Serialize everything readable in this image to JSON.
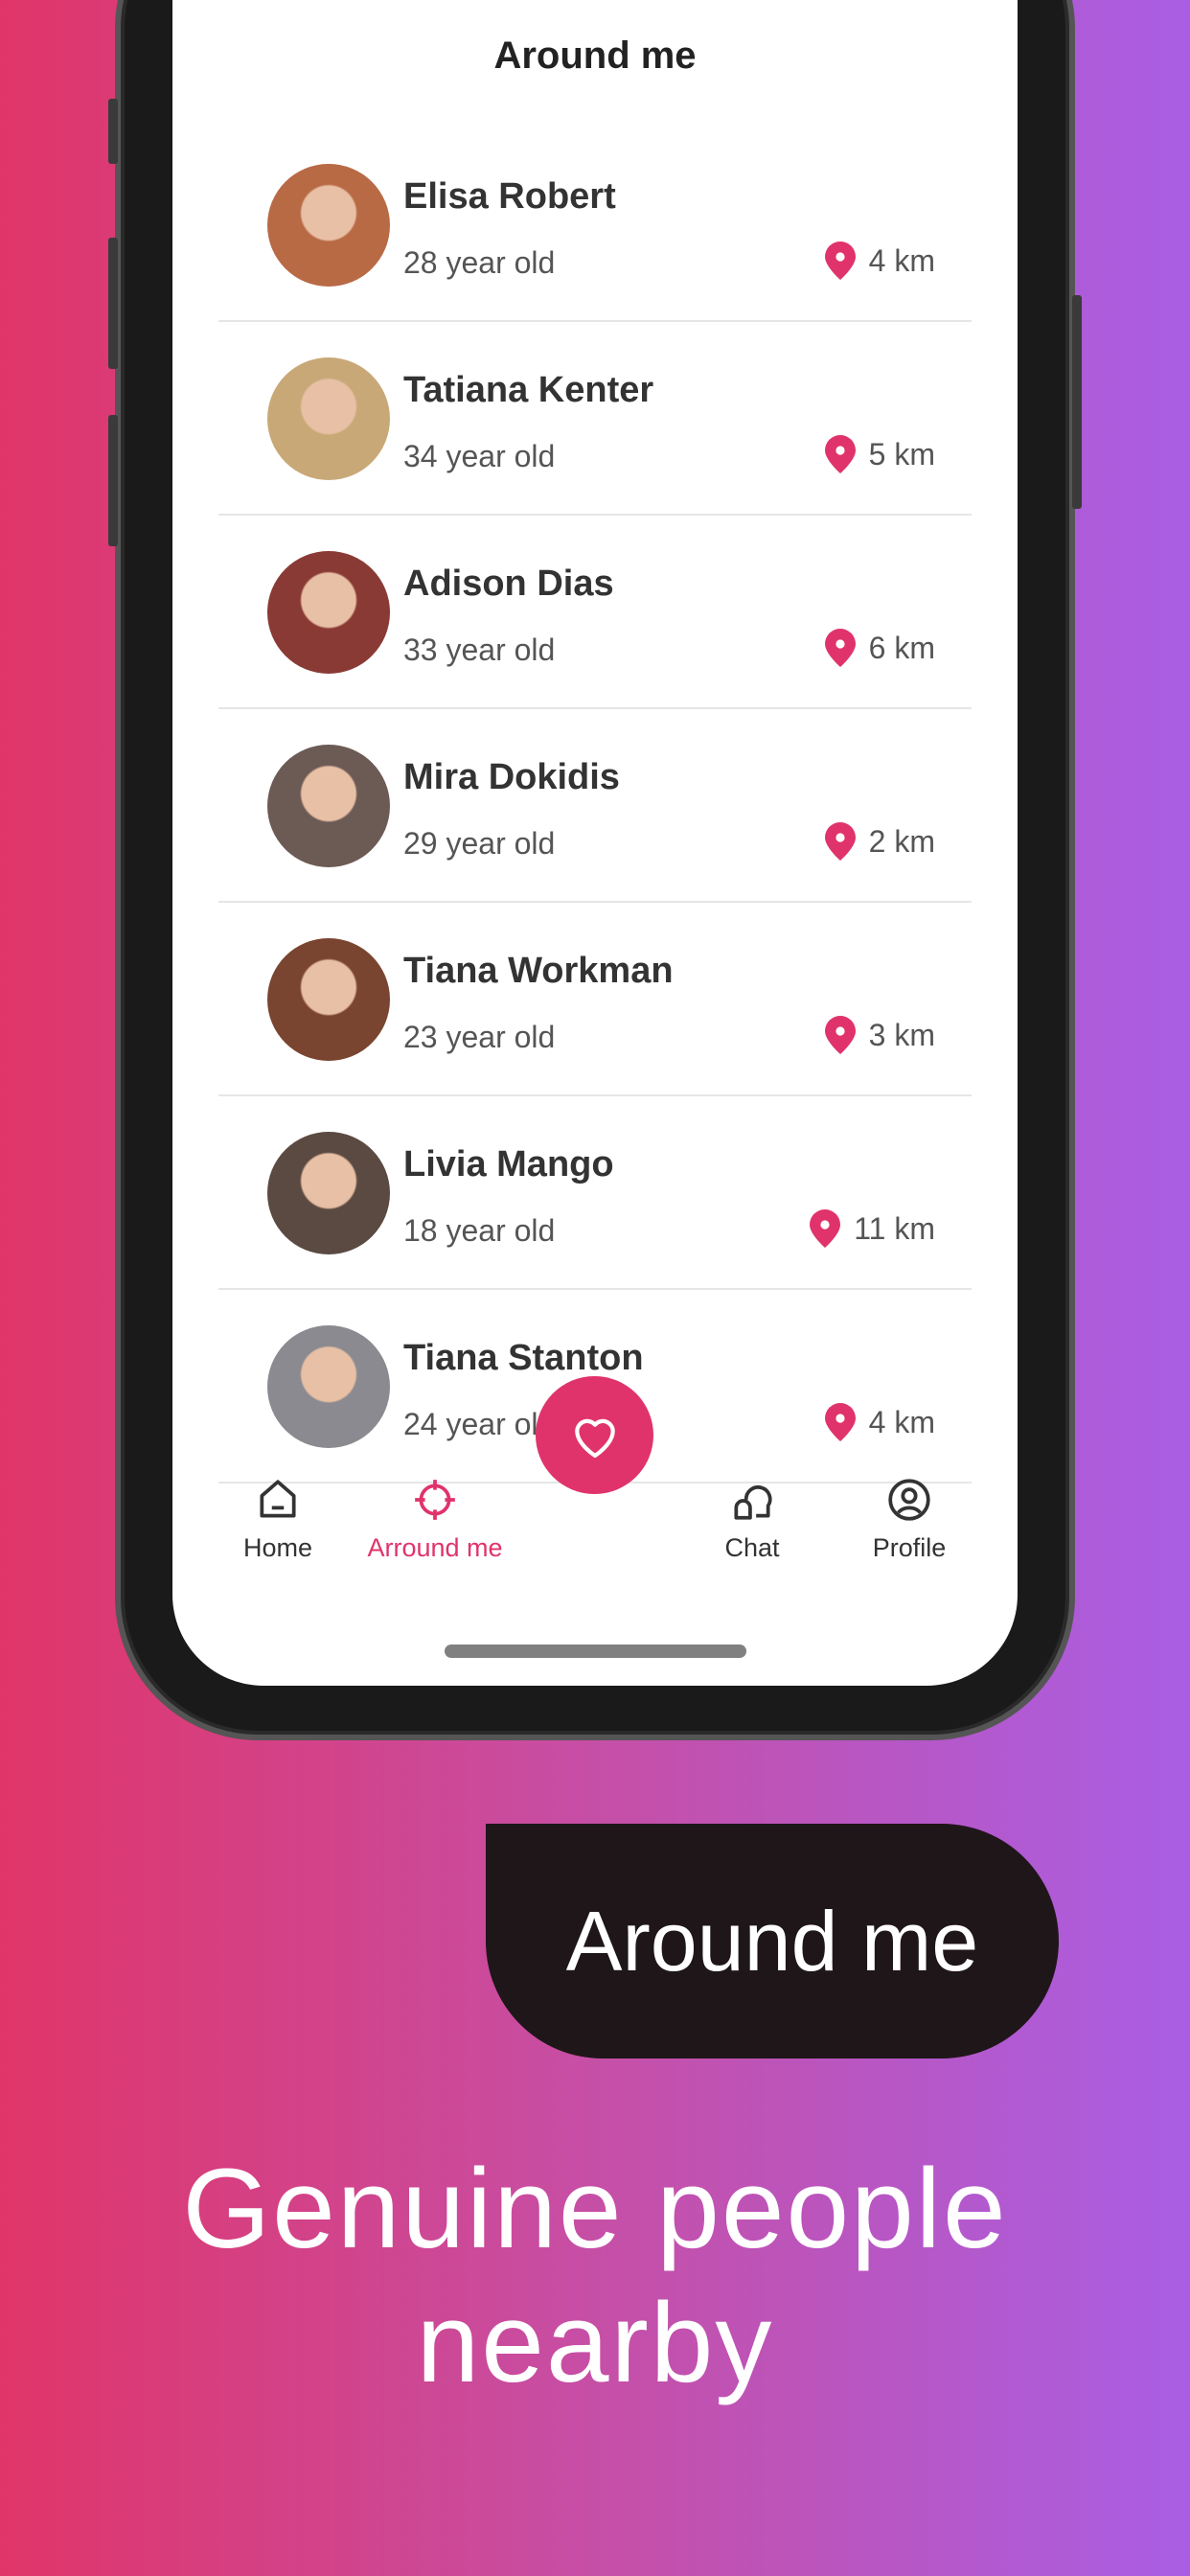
{
  "screen_title": "Around me",
  "people": [
    {
      "name": "Elisa Robert",
      "age": "28 year old",
      "distance": "4 km",
      "avatar_color": "#b86a45"
    },
    {
      "name": "Tatiana Kenter",
      "age": "34 year old",
      "distance": "5 km",
      "avatar_color": "#c9a878"
    },
    {
      "name": "Adison Dias",
      "age": "33 year old",
      "distance": "6 km",
      "avatar_color": "#8a3a35"
    },
    {
      "name": "Mira Dokidis",
      "age": "29 year old",
      "distance": "2 km",
      "avatar_color": "#6c5a55"
    },
    {
      "name": "Tiana Workman",
      "age": "23 year old",
      "distance": "3 km",
      "avatar_color": "#7a4530"
    },
    {
      "name": "Livia Mango",
      "age": "18 year old",
      "distance": "11 km",
      "avatar_color": "#5b4a42"
    },
    {
      "name": "Tiana Stanton",
      "age": "24 year old",
      "distance": "4 km",
      "avatar_color": "#8a8a90"
    }
  ],
  "nav": {
    "items": [
      {
        "label": "Home",
        "icon": "home-icon",
        "active": false
      },
      {
        "label": "Arround me",
        "icon": "crosshair-icon",
        "active": true
      },
      {
        "label": "Chat",
        "icon": "chat-icon",
        "active": false
      },
      {
        "label": "Profile",
        "icon": "profile-icon",
        "active": false
      }
    ],
    "center_icon": "heart-icon"
  },
  "feature_pill": "Around me",
  "headline": "Genuine people nearby",
  "colors": {
    "accent": "#e0336b",
    "pill": "#1f1619",
    "gradient_left": "#e03569",
    "gradient_right": "#a95ee4"
  }
}
